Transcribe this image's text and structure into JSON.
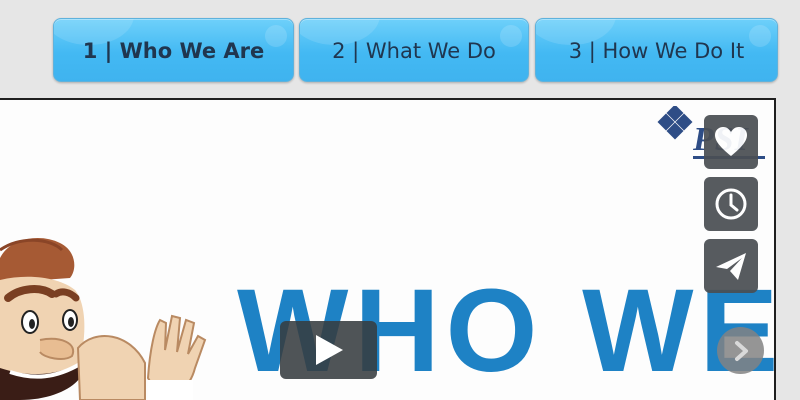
{
  "tabs": [
    {
      "label": "1 | Who We Are",
      "active": true
    },
    {
      "label": "2 | What We Do",
      "active": false
    },
    {
      "label": "3 | How We Do It",
      "active": false
    }
  ],
  "slide": {
    "headline": "WHO WE",
    "logo_text": "PSI"
  },
  "controls": {
    "like_icon": "heart-icon",
    "history_icon": "clock-icon",
    "share_icon": "paper-plane-icon",
    "next_icon": "chevron-right-icon",
    "play_icon": "play-icon"
  },
  "colors": {
    "tab_blue": "#43b9f3",
    "headline_blue": "#1e82c5",
    "control_gray": "#4b4f54"
  }
}
